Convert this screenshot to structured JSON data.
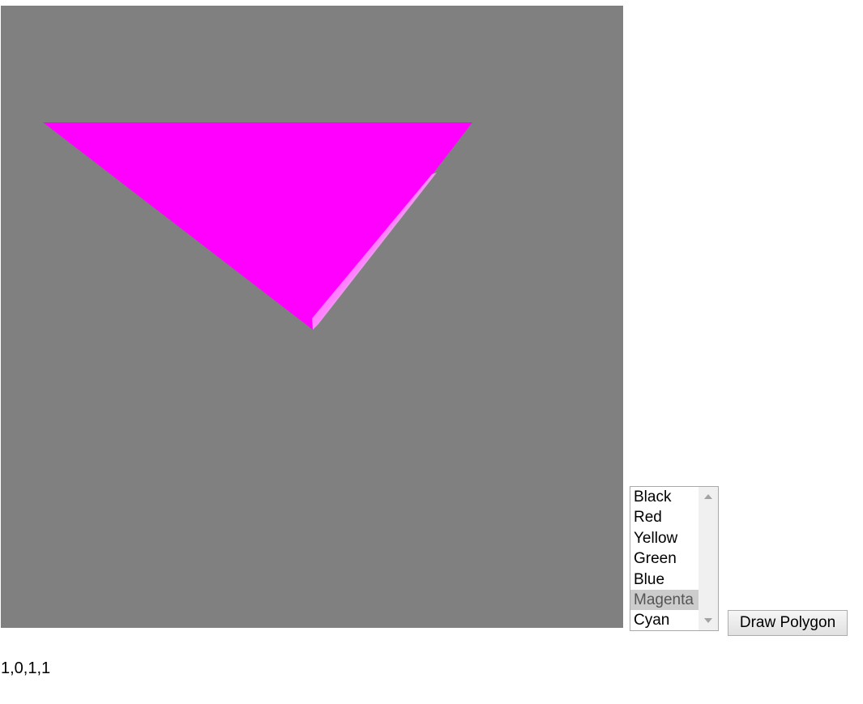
{
  "canvas": {
    "background_color": "#808080",
    "polygon": {
      "shape": "triangle",
      "fill_color": "#ff00ff",
      "vertex_count": 3
    }
  },
  "color_list": {
    "options": [
      "Black",
      "Red",
      "Yellow",
      "Green",
      "Blue",
      "Magenta",
      "Cyan"
    ],
    "selected": "Magenta",
    "icons": {
      "scroll_up": "triangle-up-icon",
      "scroll_down": "triangle-down-icon"
    }
  },
  "toolbar": {
    "draw_label": "Draw Polygon"
  },
  "status": {
    "value": "1,0,1,1"
  }
}
